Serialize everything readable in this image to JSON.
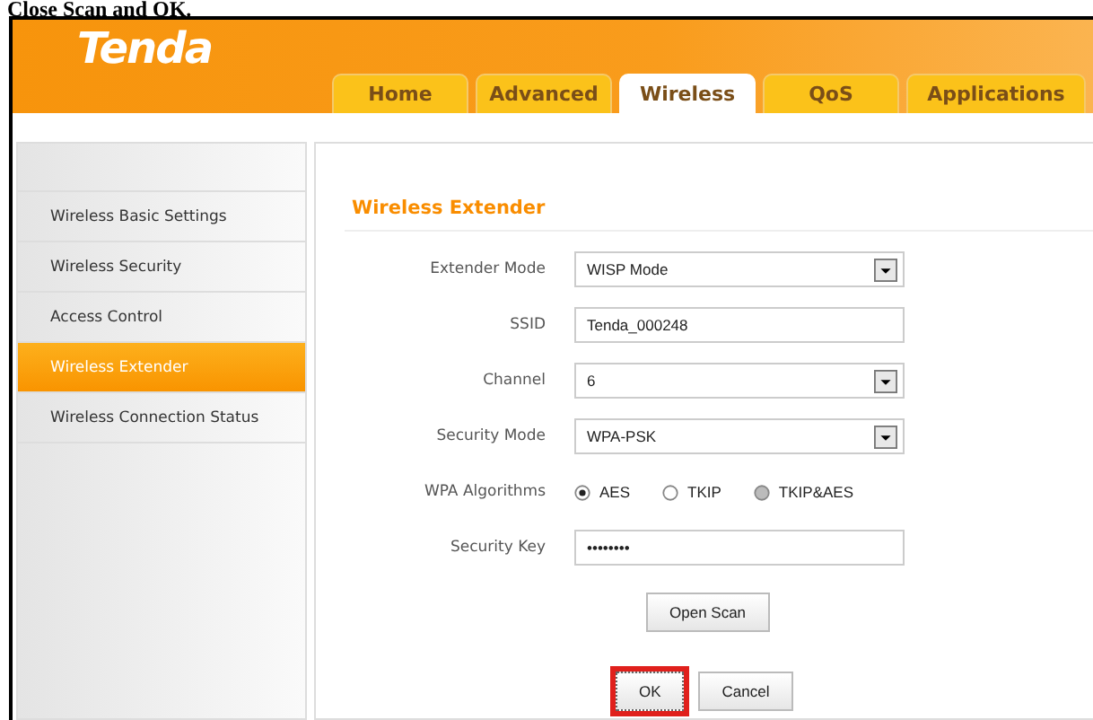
{
  "caption": "Close Scan and OK.",
  "logo": "Tenda",
  "tabs": [
    {
      "label": "Home",
      "selected": false
    },
    {
      "label": "Advanced",
      "selected": false
    },
    {
      "label": "Wireless",
      "selected": true
    },
    {
      "label": "QoS",
      "selected": false
    },
    {
      "label": "Applications",
      "selected": false
    }
  ],
  "sidebar": {
    "items": [
      {
        "label": "Wireless Basic Settings",
        "selected": false
      },
      {
        "label": "Wireless Security",
        "selected": false
      },
      {
        "label": "Access Control",
        "selected": false
      },
      {
        "label": "Wireless Extender",
        "selected": true
      },
      {
        "label": "Wireless Connection Status",
        "selected": false
      }
    ]
  },
  "section_title": "Wireless Extender",
  "fields": [
    {
      "kind": "select",
      "label": "Extender Mode",
      "value": "WISP Mode"
    },
    {
      "kind": "text",
      "label": "SSID",
      "value": "Tenda_000248"
    },
    {
      "kind": "select",
      "label": "Channel",
      "value": "6"
    },
    {
      "kind": "select",
      "label": "Security Mode",
      "value": "WPA-PSK"
    },
    {
      "kind": "radio",
      "label": "WPA Algorithms",
      "options": [
        {
          "label": "AES",
          "selected": true,
          "disabled": false
        },
        {
          "label": "TKIP",
          "selected": false,
          "disabled": false
        },
        {
          "label": "TKIP&AES",
          "selected": false,
          "disabled": true
        }
      ]
    },
    {
      "kind": "text",
      "label": "Security Key",
      "value": "••••••••"
    }
  ],
  "scan_button": "Open Scan",
  "buttons": [
    {
      "label": "OK",
      "highlighted": true
    },
    {
      "label": "Cancel",
      "highlighted": false
    }
  ]
}
